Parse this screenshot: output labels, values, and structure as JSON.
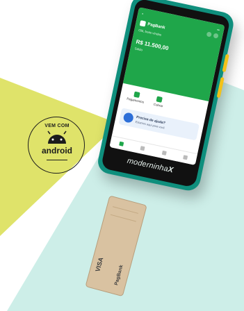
{
  "badge": {
    "top_text": "VEM COM",
    "word": "android"
  },
  "device": {
    "brand_prefix": "m",
    "brand_main": "oderninha",
    "brand_suffix": "X",
    "app": {
      "name": "PagBank",
      "greeting": "Olá, boas vindas",
      "balance": "R$ 11.500,00",
      "balance_label": "Saldo",
      "quick_actions": [
        "Pagamentos",
        "Cobrar"
      ],
      "promo_title": "Precisa de ajuda?",
      "promo_subtitle": "Estamos aqui para você"
    }
  },
  "card": {
    "network": "VISA",
    "issuer": "PagBank"
  },
  "colors": {
    "yellow": "#dfe36a",
    "mint": "#cdeee8",
    "teal_shell": "#0f8f7d",
    "app_green": "#1fa64a",
    "accent_buttons": "#f2c21a"
  }
}
